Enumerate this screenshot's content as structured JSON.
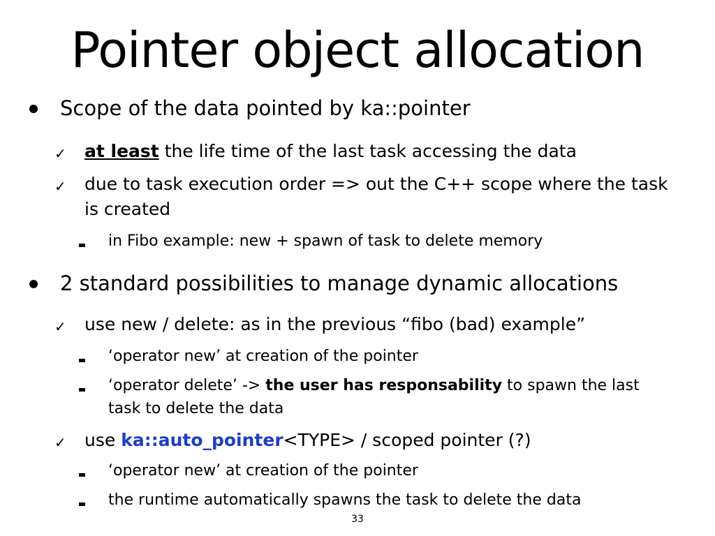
{
  "slide": {
    "title": "Pointer object allocation",
    "page_number": "33",
    "colors": {
      "text": "#000000",
      "highlight": "#1f3fbf"
    },
    "bullets": [
      {
        "text": "Scope of the data pointed by ka::pointer",
        "items": [
          {
            "emphasis": "at least",
            "rest": " the life time of the last task accessing the data"
          },
          {
            "line1": "due to task execution order => out the C++ scope where the task",
            "line2": "is created",
            "items": [
              "in Fibo example: new + spawn of task to delete memory"
            ]
          }
        ]
      },
      {
        "text": "2 standard possibilities to manage dynamic allocations",
        "items": [
          {
            "text": "use new / delete: as in the previous “fibo (bad) example”",
            "items": [
              {
                "text": "‘operator new’ at creation of the pointer"
              },
              {
                "pre": "‘operator delete’ -> ",
                "bold": "the user has responsability",
                "post": " to spawn the last",
                "line2": "task to delete the data"
              }
            ]
          },
          {
            "pre": "use ",
            "highlight": "ka::auto_pointer",
            "post": "<TYPE> / scoped pointer (?)",
            "items": [
              "‘operator new’ at creation of the pointer",
              "the runtime automatically spawns the task to delete the data"
            ]
          }
        ]
      }
    ]
  }
}
